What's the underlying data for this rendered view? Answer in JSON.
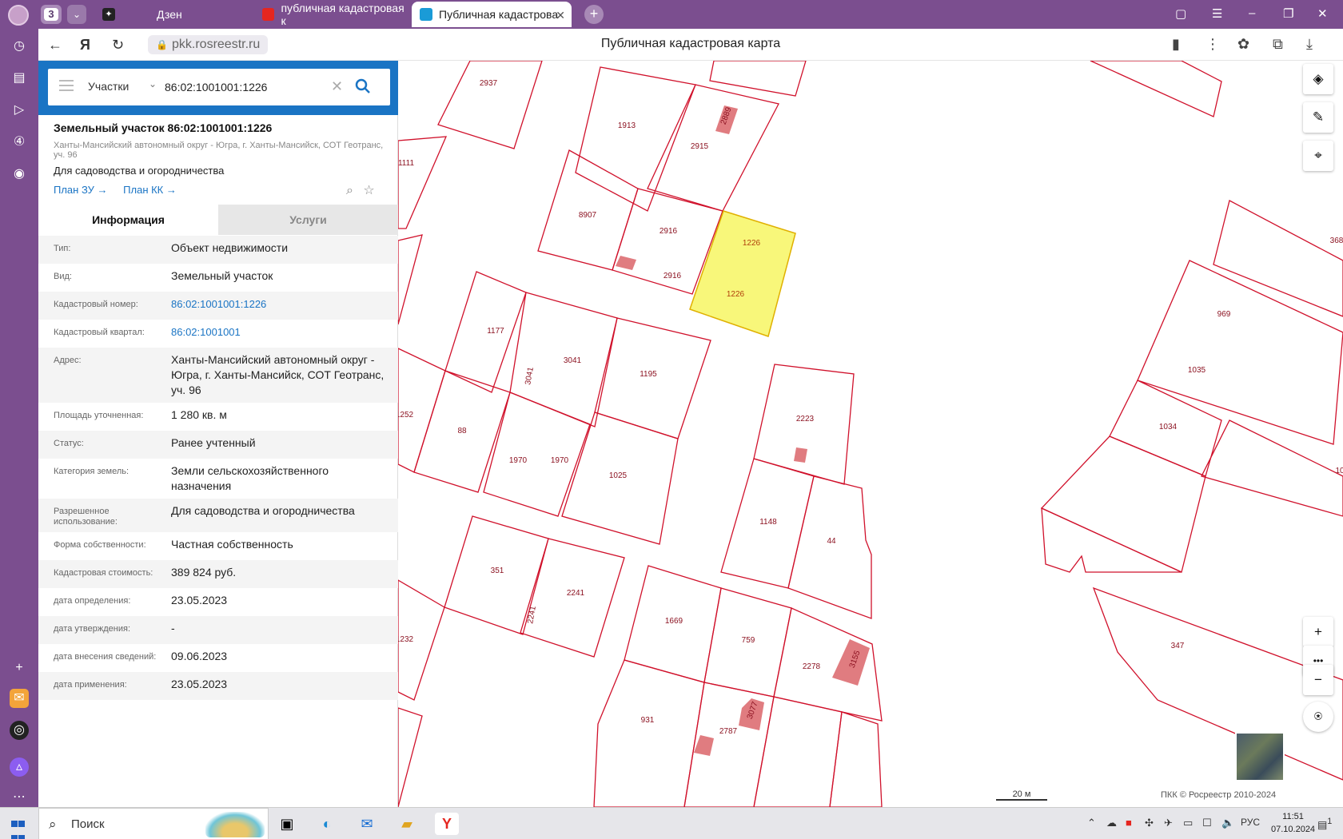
{
  "browser": {
    "tab_count": "3",
    "tabs": [
      {
        "label": "Дзен"
      },
      {
        "label": "публичная кадастровая к"
      },
      {
        "label": "Публичная кадастрова"
      }
    ],
    "url": "pkk.rosreestr.ru",
    "page_title": "Публичная кадастровая карта"
  },
  "search": {
    "category": "Участки",
    "query": "86:02:1001001:1226"
  },
  "object": {
    "title": "Земельный участок 86:02:1001001:1226",
    "address": "Ханты-Мансийский автономный округ - Югра, г. Ханты-Мансийск, СОТ Геотранс, уч. 96",
    "use": "Для садоводства и огородничества",
    "plan_zu": "План ЗУ →",
    "plan_kk": "План КК →"
  },
  "tabs": {
    "info": "Информация",
    "services": "Услуги"
  },
  "fields": [
    {
      "k": "Тип:",
      "v": "Объект недвижимости",
      "link": false
    },
    {
      "k": "Вид:",
      "v": "Земельный участок",
      "link": false
    },
    {
      "k": "Кадастровый номер:",
      "v": "86:02:1001001:1226",
      "link": true
    },
    {
      "k": "Кадастровый квартал:",
      "v": "86:02:1001001",
      "link": true
    },
    {
      "k": "Адрес:",
      "v": "Ханты-Мансийский автономный округ - Югра, г. Ханты-Мансийск, СОТ Геотранс, уч. 96",
      "link": false
    },
    {
      "k": "Площадь уточненная:",
      "v": "1 280 кв. м",
      "link": false
    },
    {
      "k": "Статус:",
      "v": "Ранее учтенный",
      "link": false
    },
    {
      "k": "Категория земель:",
      "v": "Земли сельскохозяйственного назначения",
      "link": false
    },
    {
      "k": "Разрешенное использование:",
      "v": "Для садоводства и огородничества",
      "link": false
    },
    {
      "k": "Форма собственности:",
      "v": "Частная собственность",
      "link": false
    },
    {
      "k": "Кадастровая стоимость:",
      "v": "389 824 руб.",
      "link": false
    },
    {
      "k": "дата определения:",
      "v": "23.05.2023",
      "link": false
    },
    {
      "k": "дата утверждения:",
      "v": "-",
      "link": false
    },
    {
      "k": "дата внесения сведений:",
      "v": "09.06.2023",
      "link": false
    },
    {
      "k": "дата применения:",
      "v": "23.05.2023",
      "link": false
    }
  ],
  "map": {
    "parcel_labels": [
      "2937",
      "1111",
      "1913",
      "2915",
      "2889",
      "8907",
      "2916",
      "2916",
      "1226",
      "1226",
      "1177",
      "3041",
      "3041",
      "1195",
      "1252",
      "88",
      "1970",
      "1970",
      "1025",
      "2223",
      "1148",
      "44",
      "351",
      "2241",
      "2241",
      "1232",
      "1669",
      "759",
      "2278",
      "3155",
      "931",
      "2787",
      "3077",
      "368",
      "969",
      "1035",
      "1034",
      "347",
      "10"
    ],
    "scale_label": "20 м",
    "copyright": "ПКК © Росреестр 2010-2024",
    "colors": {
      "parcel_border": "#d0112b",
      "selected_fill": "#f8f77a",
      "building_fill": "#e07c80"
    }
  },
  "taskbar": {
    "search_label": "Поиск",
    "lang": "РУС",
    "time": "11:51",
    "date": "07.10.2024",
    "notif_count": "1"
  }
}
